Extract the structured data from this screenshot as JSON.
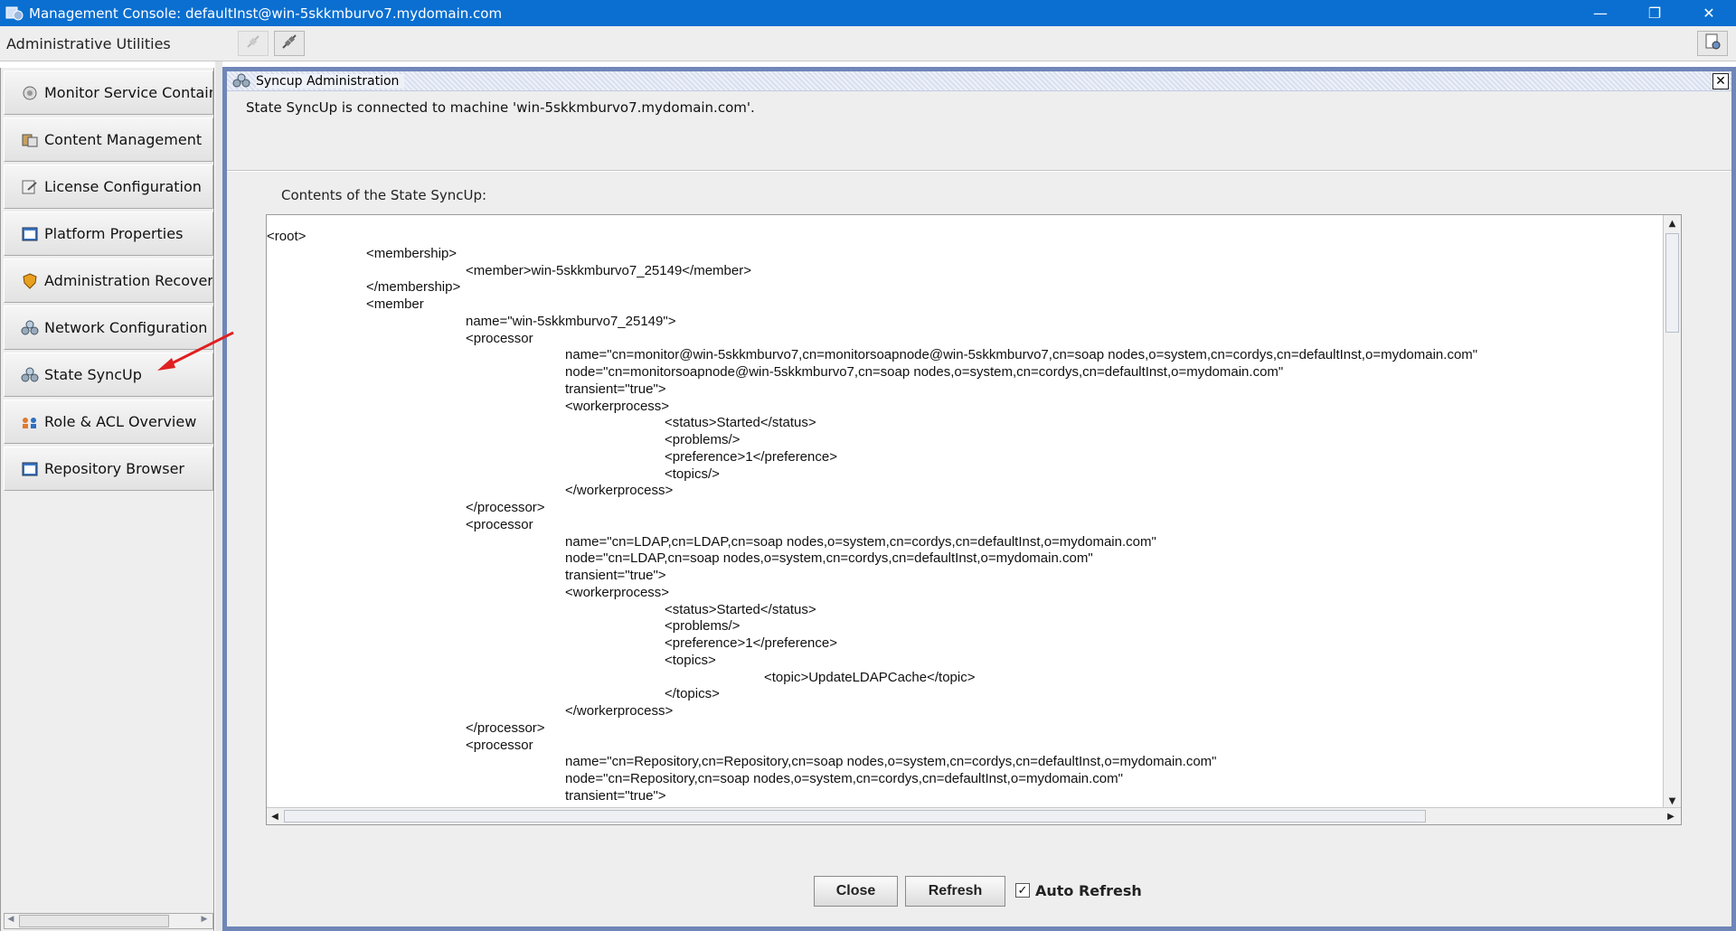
{
  "window": {
    "title": "Management Console: defaultInst@win-5skkmburvo7.mydomain.com",
    "controls": {
      "minimize": "—",
      "restore": "❐",
      "close": "✕"
    }
  },
  "toolbar": {
    "label": "Administrative Utilities"
  },
  "sidebar": {
    "items": [
      {
        "label": "Monitor Service Container",
        "icon": "monitor-icon"
      },
      {
        "label": "Content Management",
        "icon": "content-icon"
      },
      {
        "label": "License Configuration",
        "icon": "license-icon"
      },
      {
        "label": "Platform Properties",
        "icon": "properties-icon"
      },
      {
        "label": "Administration Recovery",
        "icon": "shield-icon"
      },
      {
        "label": "Network Configuration",
        "icon": "network-icon"
      },
      {
        "label": "State SyncUp",
        "icon": "sync-icon"
      },
      {
        "label": "Role & ACL Overview",
        "icon": "roles-icon"
      },
      {
        "label": "Repository Browser",
        "icon": "repository-icon"
      }
    ]
  },
  "panel": {
    "title": "Syncup Administration",
    "status": "State SyncUp is connected  to machine 'win-5skkmburvo7.mydomain.com'.",
    "contents_label": "Contents of the State SyncUp:",
    "xml_lines": [
      "<root>",
      "\t<membership>",
      "\t\t<member>win-5skkmburvo7_25149</member>",
      "\t</membership>",
      "\t<member",
      "\t\tname=\"win-5skkmburvo7_25149\">",
      "\t\t<processor",
      "\t\t\tname=\"cn=monitor@win-5skkmburvo7,cn=monitorsoapnode@win-5skkmburvo7,cn=soap nodes,o=system,cn=cordys,cn=defaultInst,o=mydomain.com\"",
      "\t\t\tnode=\"cn=monitorsoapnode@win-5skkmburvo7,cn=soap nodes,o=system,cn=cordys,cn=defaultInst,o=mydomain.com\"",
      "\t\t\ttransient=\"true\">",
      "\t\t\t<workerprocess>",
      "\t\t\t\t<status>Started</status>",
      "\t\t\t\t<problems/>",
      "\t\t\t\t<preference>1</preference>",
      "\t\t\t\t<topics/>",
      "\t\t\t</workerprocess>",
      "\t\t</processor>",
      "\t\t<processor",
      "\t\t\tname=\"cn=LDAP,cn=LDAP,cn=soap nodes,o=system,cn=cordys,cn=defaultInst,o=mydomain.com\"",
      "\t\t\tnode=\"cn=LDAP,cn=soap nodes,o=system,cn=cordys,cn=defaultInst,o=mydomain.com\"",
      "\t\t\ttransient=\"true\">",
      "\t\t\t<workerprocess>",
      "\t\t\t\t<status>Started</status>",
      "\t\t\t\t<problems/>",
      "\t\t\t\t<preference>1</preference>",
      "\t\t\t\t<topics>",
      "\t\t\t\t\t<topic>UpdateLDAPCache</topic>",
      "\t\t\t\t</topics>",
      "\t\t\t</workerprocess>",
      "\t\t</processor>",
      "\t\t<processor",
      "\t\t\tname=\"cn=Repository,cn=Repository,cn=soap nodes,o=system,cn=cordys,cn=defaultInst,o=mydomain.com\"",
      "\t\t\tnode=\"cn=Repository,cn=soap nodes,o=system,cn=cordys,cn=defaultInst,o=mydomain.com\"",
      "\t\t\ttransient=\"true\">"
    ],
    "buttons": {
      "close": "Close",
      "refresh": "Refresh"
    },
    "auto_refresh": {
      "label": "Auto Refresh",
      "checked": true,
      "mark": "✓"
    }
  },
  "colors": {
    "titlebar": "#0a6fd0",
    "frame_border": "#6f86b8",
    "annotation_arrow": "#e02020"
  }
}
